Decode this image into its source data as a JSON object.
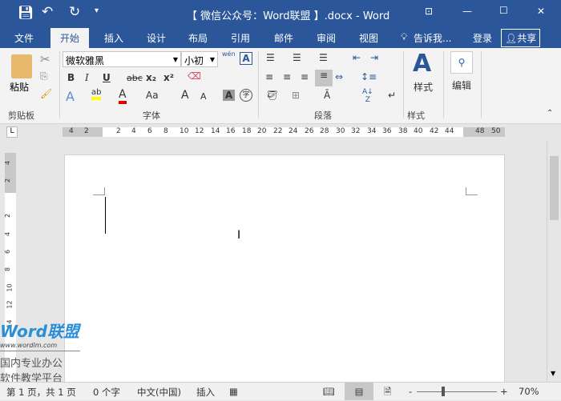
{
  "title": "【 微信公众号：Word联盟 】.docx - Word",
  "qat": {
    "save": "save-icon",
    "undo": "undo-icon",
    "redo": "redo-icon",
    "customize": "▾"
  },
  "window": {
    "ribbon_opts": "⊡",
    "minimize": "—",
    "maximize": "☐",
    "close": "✕"
  },
  "tabs": [
    "文件",
    "开始",
    "插入",
    "设计",
    "布局",
    "引用",
    "邮件",
    "审阅",
    "视图"
  ],
  "tell_me": "告诉我...",
  "login": "登录",
  "share": "共享",
  "clipboard": {
    "paste": "粘贴",
    "label": "剪贴板"
  },
  "font": {
    "name": "微软雅黑",
    "size": "小初",
    "bold": "B",
    "italic": "I",
    "underline": "U",
    "strike": "abc",
    "sub": "x₂",
    "sup": "x²",
    "case": "Aa",
    "grow": "A",
    "shrink": "A",
    "shade": "A",
    "enclose": "字",
    "phonetic": "wén",
    "border_char": "A",
    "label": "字体",
    "highlight_color": "#ffff00",
    "font_color": "#e00000"
  },
  "paragraph": {
    "label": "段落"
  },
  "styles": {
    "button": "样式",
    "label": "样式"
  },
  "editing": {
    "button": "编辑"
  },
  "ruler": {
    "h_ticks": [
      "4",
      "2",
      "2",
      "4",
      "6",
      "8",
      "10",
      "12",
      "14",
      "16",
      "18",
      "20",
      "22",
      "24",
      "26",
      "28",
      "30",
      "32",
      "34",
      "36",
      "38",
      "40",
      "42",
      "44",
      "48",
      "50"
    ],
    "v_ticks": [
      "4",
      "2",
      "2",
      "4",
      "6",
      "8",
      "10",
      "12",
      "14"
    ]
  },
  "watermark": {
    "logo": "Word联盟",
    "url": "www.wordlm.com",
    "line1": "国内专业办公",
    "line2": "软件教学平台"
  },
  "status": {
    "page": "第 1 页，共 1 页",
    "words": "0 个字",
    "lang": "中文(中国)",
    "mode": "插入",
    "zoom": "70%",
    "zoom_level": 70
  }
}
